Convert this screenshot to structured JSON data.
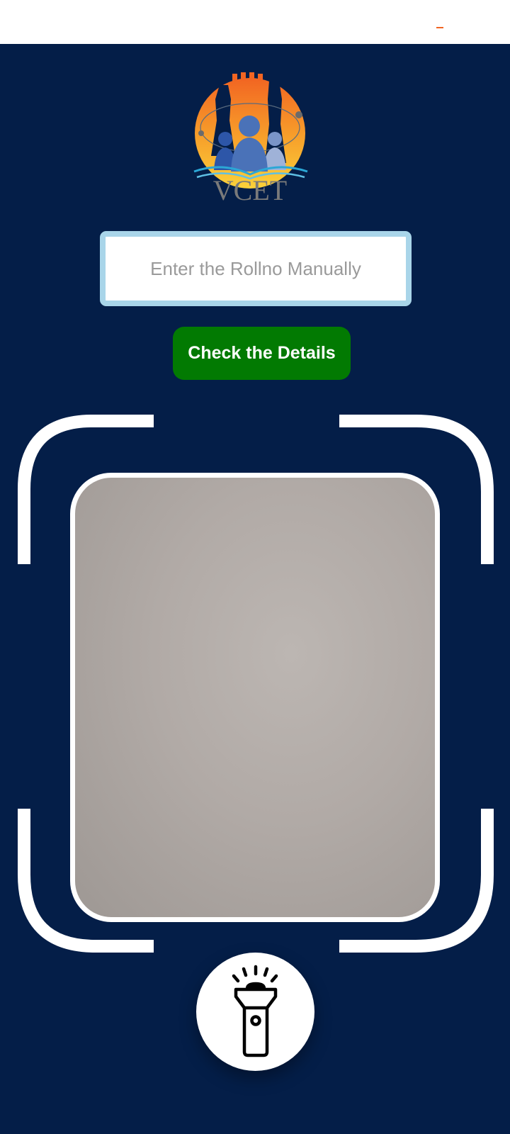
{
  "app": {
    "logo_text": "VCET"
  },
  "roll_input": {
    "placeholder": "Enter the Rollno Manually",
    "value": ""
  },
  "check_button": {
    "label": "Check the Details"
  },
  "camera": {
    "state": "live-preview"
  },
  "flash_button": {
    "icon": "flashlight-icon"
  },
  "colors": {
    "background": "#041e48",
    "button_green": "#027a02",
    "input_border": "#a9d5e9",
    "frame_white": "#ffffff",
    "logo_orange": "#f26522",
    "logo_yellow": "#fbd13a",
    "logo_blue": "#2f5fae"
  }
}
